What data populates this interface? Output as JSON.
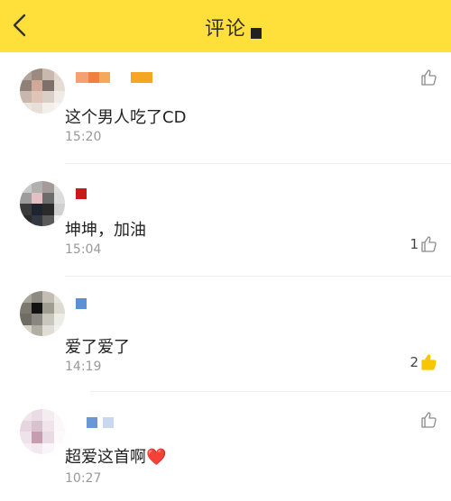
{
  "header": {
    "title": "评论"
  },
  "comments": [
    {
      "text": "这个男人吃了CD",
      "time": "15:20",
      "likes": "",
      "liked": false
    },
    {
      "text": "坤坤，加油",
      "time": "15:04",
      "likes": "1",
      "liked": false
    },
    {
      "text": "爱了爱了",
      "time": "14:19",
      "likes": "2",
      "liked": true
    },
    {
      "text": "超爱这首啊❤️",
      "time": "10:27",
      "likes": "",
      "liked": false
    }
  ],
  "colors": {
    "header_bg": "#ffe03a",
    "like_active": "#f7c600",
    "like_inactive": "#8a8a8a"
  }
}
